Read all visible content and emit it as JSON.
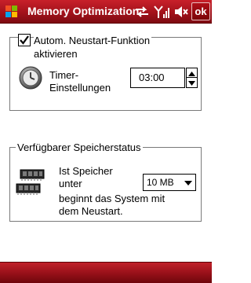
{
  "titlebar": {
    "title": "Memory Optimization",
    "ok_label": "ok",
    "icons": [
      "windows-start-icon",
      "connectivity-icon",
      "signal-icon",
      "volume-mute-icon"
    ]
  },
  "timer_group": {
    "checkbox_checked": true,
    "checkbox_label_line1": "Autom. Neustart-Funktion",
    "checkbox_label_line2": "aktivieren",
    "timer_label_line1": "Timer-",
    "timer_label_line2": "Einstellungen",
    "time_value": "03:00"
  },
  "memory_group": {
    "title": "Verfügbarer Speicherstatus",
    "text_line1": "Ist Speicher",
    "text_line2": "unter",
    "text_line3": "beginnt das System mit",
    "text_line4": "dem Neustart.",
    "threshold_selected": "10 MB"
  },
  "colors": {
    "titlebar": "#a3121b",
    "menubar": "#9a111a"
  }
}
